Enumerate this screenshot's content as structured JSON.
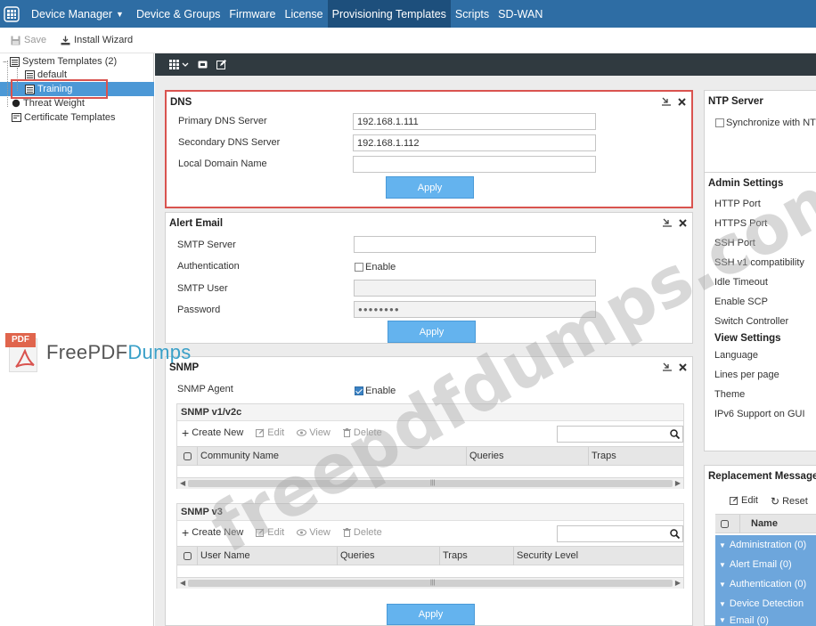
{
  "nav": {
    "items": [
      {
        "label": "Device Manager",
        "dropdown": true
      },
      {
        "label": "Device & Groups"
      },
      {
        "label": "Firmware"
      },
      {
        "label": "License"
      },
      {
        "label": "Provisioning Templates",
        "active": true
      },
      {
        "label": "Scripts"
      },
      {
        "label": "SD-WAN"
      }
    ]
  },
  "toolbar": {
    "save_label": "Save",
    "install_wizard_label": "Install Wizard"
  },
  "tree": {
    "system_templates": "System Templates (2)",
    "default": "default",
    "training": "Training",
    "threat_weight": "Threat Weight",
    "certificate_templates": "Certificate Templates"
  },
  "dns": {
    "title": "DNS",
    "primary_label": "Primary DNS Server",
    "primary_value": "192.168.1.111",
    "secondary_label": "Secondary DNS Server",
    "secondary_value": "192.168.1.112",
    "local_domain_label": "Local Domain Name",
    "local_domain_value": "",
    "apply_label": "Apply"
  },
  "alert_email": {
    "title": "Alert Email",
    "smtp_server_label": "SMTP Server",
    "authentication_label": "Authentication",
    "enable_label": "Enable",
    "smtp_user_label": "SMTP User",
    "password_label": "Password",
    "password_value": "●●●●●●●●",
    "apply_label": "Apply"
  },
  "snmp": {
    "title": "SNMP",
    "agent_label": "SNMP Agent",
    "enable_label": "Enable",
    "v1v2c": {
      "title": "SNMP v1/v2c",
      "actions": [
        "Create New",
        "Edit",
        "View",
        "Delete"
      ],
      "columns": [
        "Community Name",
        "Queries",
        "Traps"
      ]
    },
    "v3": {
      "title": "SNMP v3",
      "actions": [
        "Create New",
        "Edit",
        "View",
        "Delete"
      ],
      "columns": [
        "User Name",
        "Queries",
        "Traps",
        "Security Level"
      ]
    },
    "apply_label": "Apply"
  },
  "ntp": {
    "title": "NTP Server",
    "sync_label": "Synchronize with NTP"
  },
  "admin": {
    "title": "Admin Settings",
    "items": [
      "HTTP Port",
      "HTTPS Port",
      "SSH Port",
      "SSH v1 compatibility",
      "Idle Timeout",
      "Enable SCP",
      "Switch Controller"
    ],
    "view_settings_title": "View Settings",
    "view_items": [
      "Language",
      "Lines per page",
      "Theme",
      "IPv6 Support on GUI"
    ]
  },
  "replacement": {
    "title": "Replacement Message",
    "edit_label": "Edit",
    "reset_label": "Reset",
    "name_col": "Name",
    "groups": [
      "Administration (0)",
      "Alert Email (0)",
      "Authentication (0)",
      "Device Detection",
      "Email (0)"
    ]
  },
  "watermark": {
    "brand_pdf": "PDF",
    "brand_free": "Free",
    "brand_pdf2": "PDF",
    "brand_dumps": "Dumps",
    "diagonal": "freepdfdumps.com"
  }
}
